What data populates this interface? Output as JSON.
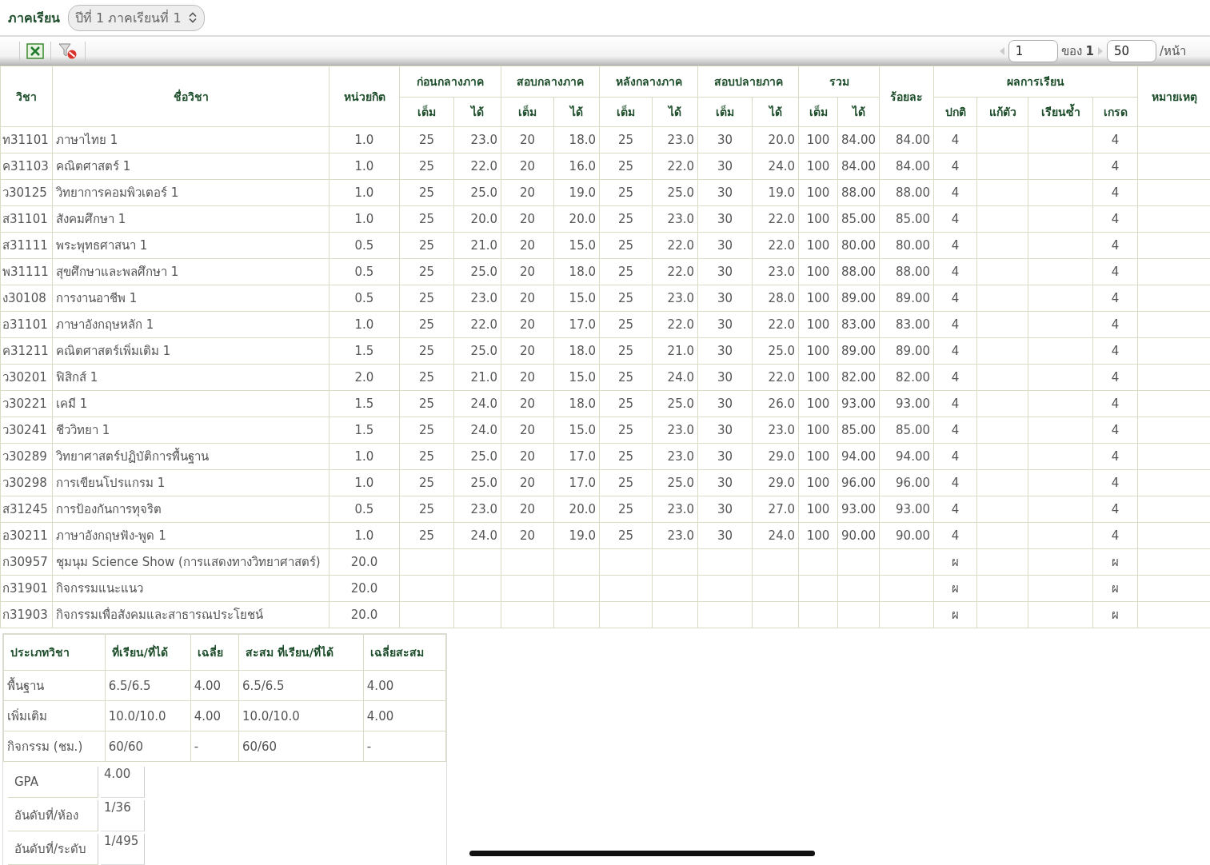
{
  "term": {
    "label": "ภาคเรียน",
    "value": "ปีที่ 1 ภาคเรียนที่ 1"
  },
  "pager": {
    "page": "1",
    "of_label": "ของ",
    "total_pages": "1",
    "page_size": "50",
    "per_page_label": "/หน้า"
  },
  "table": {
    "columns": {
      "code": "วิชา",
      "name": "ชื่อวิชา",
      "credits": "หน่วยกิต",
      "groups": [
        {
          "label": "ก่อนกลางภาค",
          "full": "เต็ม",
          "got": "ได้"
        },
        {
          "label": "สอบกลางภาค",
          "full": "เต็ม",
          "got": "ได้"
        },
        {
          "label": "หลังกลางภาค",
          "full": "เต็ม",
          "got": "ได้"
        },
        {
          "label": "สอบปลายภาค",
          "full": "เต็ม",
          "got": "ได้"
        },
        {
          "label": "รวม",
          "full": "เต็ม",
          "got": "ได้"
        }
      ],
      "percent": "ร้อยละ",
      "result": "ผลการเรียน",
      "result_cols": [
        "ปกติ",
        "แก้ตัว",
        "เรียนซ้ำ",
        "เกรด"
      ],
      "note": "หมายเหตุ"
    },
    "rows": [
      {
        "code": "ท31101",
        "name": "ภาษาไทย 1",
        "credits": "1.0",
        "scores": [
          "25",
          "23.0",
          "20",
          "18.0",
          "25",
          "23.0",
          "30",
          "20.0",
          "100",
          "84.00"
        ],
        "percent": "84.00",
        "normal": "4",
        "grade": "4"
      },
      {
        "code": "ค31103",
        "name": "คณิตศาสตร์ 1",
        "credits": "1.0",
        "scores": [
          "25",
          "22.0",
          "20",
          "16.0",
          "25",
          "22.0",
          "30",
          "24.0",
          "100",
          "84.00"
        ],
        "percent": "84.00",
        "normal": "4",
        "grade": "4"
      },
      {
        "code": "ว30125",
        "name": "วิทยาการคอมพิวเตอร์ 1",
        "credits": "1.0",
        "scores": [
          "25",
          "25.0",
          "20",
          "19.0",
          "25",
          "25.0",
          "30",
          "19.0",
          "100",
          "88.00"
        ],
        "percent": "88.00",
        "normal": "4",
        "grade": "4"
      },
      {
        "code": "ส31101",
        "name": "สังคมศึกษา 1",
        "credits": "1.0",
        "scores": [
          "25",
          "20.0",
          "20",
          "20.0",
          "25",
          "23.0",
          "30",
          "22.0",
          "100",
          "85.00"
        ],
        "percent": "85.00",
        "normal": "4",
        "grade": "4"
      },
      {
        "code": "ส31111",
        "name": "พระพุทธศาสนา 1",
        "credits": "0.5",
        "scores": [
          "25",
          "21.0",
          "20",
          "15.0",
          "25",
          "22.0",
          "30",
          "22.0",
          "100",
          "80.00"
        ],
        "percent": "80.00",
        "normal": "4",
        "grade": "4"
      },
      {
        "code": "พ31111",
        "name": "สุขศึกษาและพลศึกษา 1",
        "credits": "0.5",
        "scores": [
          "25",
          "25.0",
          "20",
          "18.0",
          "25",
          "22.0",
          "30",
          "23.0",
          "100",
          "88.00"
        ],
        "percent": "88.00",
        "normal": "4",
        "grade": "4"
      },
      {
        "code": "ง30108",
        "name": "การงานอาชีพ 1",
        "credits": "0.5",
        "scores": [
          "25",
          "23.0",
          "20",
          "15.0",
          "25",
          "23.0",
          "30",
          "28.0",
          "100",
          "89.00"
        ],
        "percent": "89.00",
        "normal": "4",
        "grade": "4"
      },
      {
        "code": "อ31101",
        "name": "ภาษาอังกฤษหลัก 1",
        "credits": "1.0",
        "scores": [
          "25",
          "22.0",
          "20",
          "17.0",
          "25",
          "22.0",
          "30",
          "22.0",
          "100",
          "83.00"
        ],
        "percent": "83.00",
        "normal": "4",
        "grade": "4"
      },
      {
        "code": "ค31211",
        "name": "คณิตศาสตร์เพิ่มเติม 1",
        "credits": "1.5",
        "scores": [
          "25",
          "25.0",
          "20",
          "18.0",
          "25",
          "21.0",
          "30",
          "25.0",
          "100",
          "89.00"
        ],
        "percent": "89.00",
        "normal": "4",
        "grade": "4"
      },
      {
        "code": "ว30201",
        "name": "ฟิสิกส์ 1",
        "credits": "2.0",
        "scores": [
          "25",
          "21.0",
          "20",
          "15.0",
          "25",
          "24.0",
          "30",
          "22.0",
          "100",
          "82.00"
        ],
        "percent": "82.00",
        "normal": "4",
        "grade": "4"
      },
      {
        "code": "ว30221",
        "name": "เคมี 1",
        "credits": "1.5",
        "scores": [
          "25",
          "24.0",
          "20",
          "18.0",
          "25",
          "25.0",
          "30",
          "26.0",
          "100",
          "93.00"
        ],
        "percent": "93.00",
        "normal": "4",
        "grade": "4"
      },
      {
        "code": "ว30241",
        "name": "ชีววิทยา 1",
        "credits": "1.5",
        "scores": [
          "25",
          "24.0",
          "20",
          "15.0",
          "25",
          "23.0",
          "30",
          "23.0",
          "100",
          "85.00"
        ],
        "percent": "85.00",
        "normal": "4",
        "grade": "4"
      },
      {
        "code": "ว30289",
        "name": "วิทยาศาสตร์ปฏิบัติการพื้นฐาน",
        "credits": "1.0",
        "scores": [
          "25",
          "25.0",
          "20",
          "17.0",
          "25",
          "23.0",
          "30",
          "29.0",
          "100",
          "94.00"
        ],
        "percent": "94.00",
        "normal": "4",
        "grade": "4"
      },
      {
        "code": "ว30298",
        "name": "การเขียนโปรแกรม 1",
        "credits": "1.0",
        "scores": [
          "25",
          "25.0",
          "20",
          "17.0",
          "25",
          "25.0",
          "30",
          "29.0",
          "100",
          "96.00"
        ],
        "percent": "96.00",
        "normal": "4",
        "grade": "4"
      },
      {
        "code": "ส31245",
        "name": "การป้องกันการทุจริต",
        "credits": "0.5",
        "scores": [
          "25",
          "23.0",
          "20",
          "20.0",
          "25",
          "23.0",
          "30",
          "27.0",
          "100",
          "93.00"
        ],
        "percent": "93.00",
        "normal": "4",
        "grade": "4"
      },
      {
        "code": "อ30211",
        "name": "ภาษาอังกฤษฟัง-พูด 1",
        "credits": "1.0",
        "scores": [
          "25",
          "24.0",
          "20",
          "19.0",
          "25",
          "23.0",
          "30",
          "24.0",
          "100",
          "90.00"
        ],
        "percent": "90.00",
        "normal": "4",
        "grade": "4"
      },
      {
        "code": "ก30957",
        "name": "ชุมนุม Science Show (การแสดงทางวิทยาศาสตร์)",
        "credits": "20.0",
        "normal": "ผ",
        "grade": "ผ"
      },
      {
        "code": "ก31901",
        "name": "กิจกรรมแนะแนว",
        "credits": "20.0",
        "normal": "ผ",
        "grade": "ผ"
      },
      {
        "code": "ก31903",
        "name": "กิจกรรมเพื่อสังคมและสาธารณประโยชน์",
        "credits": "20.0",
        "normal": "ผ",
        "grade": "ผ"
      }
    ]
  },
  "summary": {
    "columns": [
      "ประเภทวิชา",
      "ที่เรียน/ที่ได้",
      "เฉลี่ย",
      "สะสม ที่เรียน/ที่ได้",
      "เฉลี่ยสะสม"
    ],
    "rows": [
      [
        "พื้นฐาน",
        "6.5/6.5",
        "4.00",
        "6.5/6.5",
        "4.00"
      ],
      [
        "เพิ่มเติม",
        "10.0/10.0",
        "4.00",
        "10.0/10.0",
        "4.00"
      ],
      [
        "กิจกรรม (ชม.)",
        "60/60",
        "-",
        "60/60",
        "-"
      ]
    ],
    "stats": [
      {
        "label": "GPA",
        "value": "4.00"
      },
      {
        "label": "อันดับที่/ห้อง",
        "value": "1/36"
      },
      {
        "label": "อันดับที่/ระดับ",
        "value": "1/495"
      }
    ]
  }
}
